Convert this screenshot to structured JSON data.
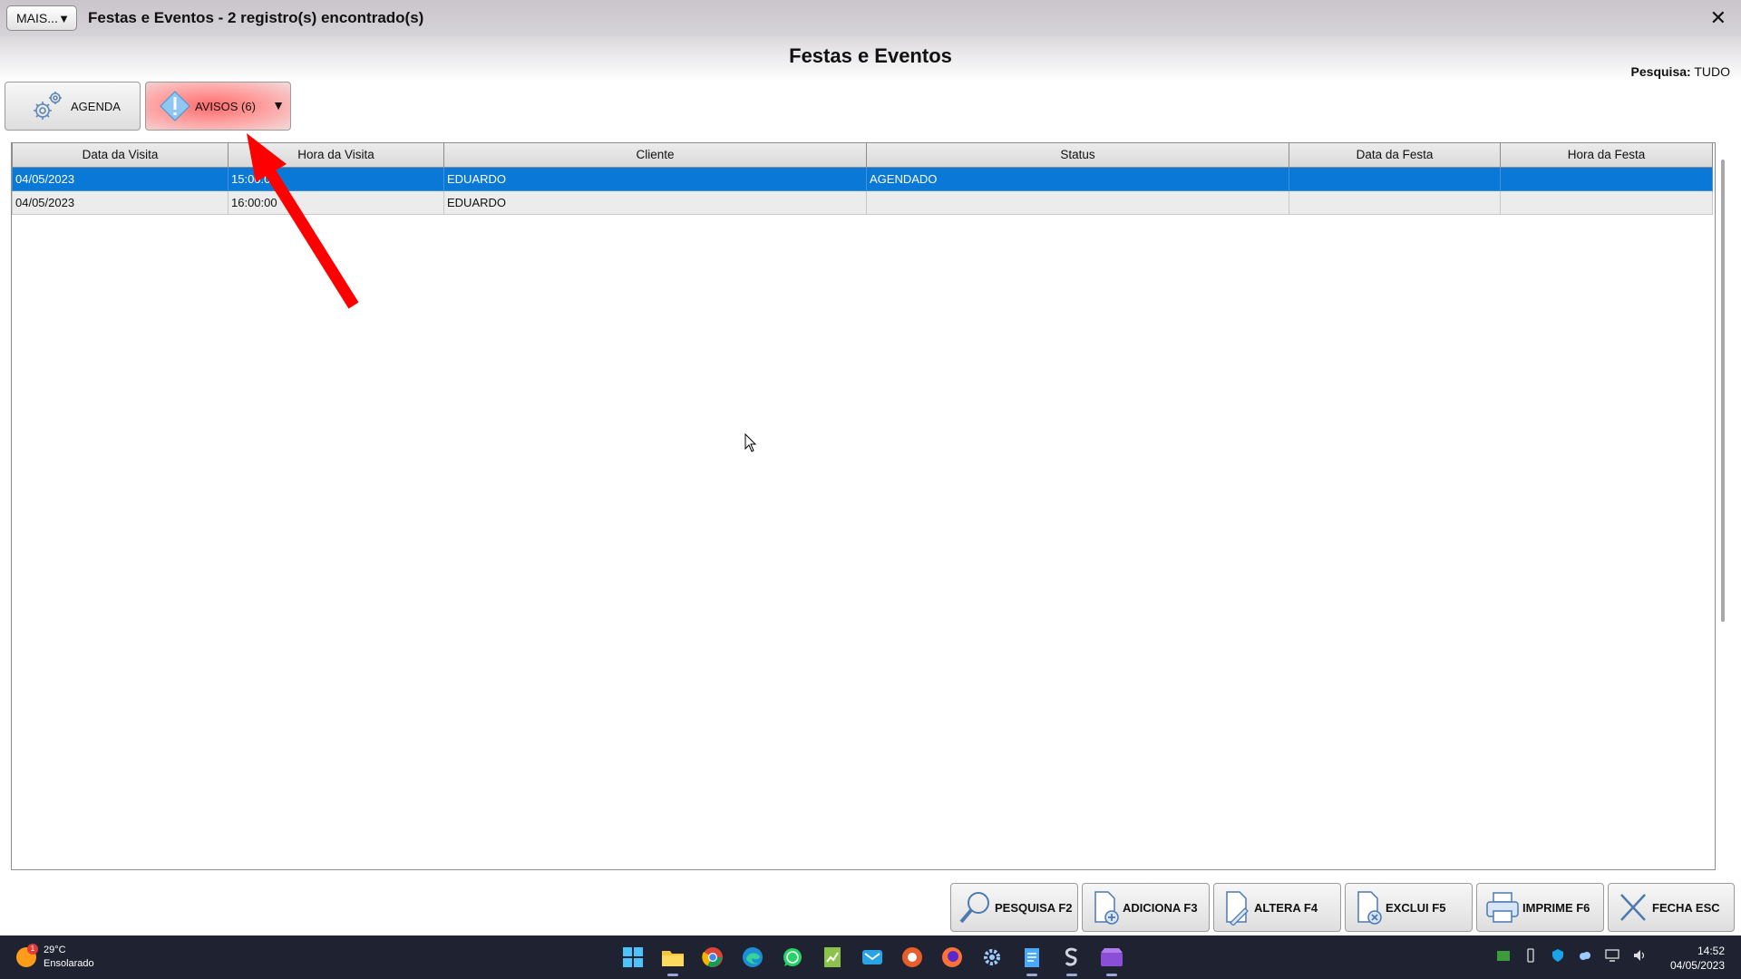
{
  "window": {
    "mais_label": "MAIS...",
    "title": "Festas e Eventos - 2 registro(s) encontrado(s)",
    "close": "✕"
  },
  "header": {
    "title": "Festas e Eventos",
    "search_label": "Pesquisa:",
    "search_value": "TUDO"
  },
  "toolbar": {
    "agenda_label": "AGENDA",
    "avisos_label": "AVISOS (6)"
  },
  "grid": {
    "columns": [
      "Data da Visita",
      "Hora da Visita",
      "Cliente",
      "Status",
      "Data da Festa",
      "Hora da Festa"
    ],
    "rows": [
      [
        "04/05/2023",
        "15:00:00",
        "EDUARDO",
        "AGENDADO",
        "",
        ""
      ],
      [
        "04/05/2023",
        "16:00:00",
        "EDUARDO",
        "",
        "",
        ""
      ]
    ]
  },
  "actions": {
    "pesquisa": "PESQUISA F2",
    "adiciona": "ADICIONA F3",
    "altera": "ALTERA F4",
    "exclui": "EXCLUI F5",
    "imprime": "IMPRIME F6",
    "fecha": "FECHA ESC"
  },
  "taskbar": {
    "weather_badge": "1",
    "temperature": "29°C",
    "condition": "Ensolarado",
    "time": "14:52",
    "date": "04/05/2023",
    "apps": [
      "windows-start-icon",
      "file-explorer-icon",
      "chrome-icon",
      "edge-icon",
      "whatsapp-icon",
      "spreadsheet-icon",
      "mail-icon",
      "media-app-icon",
      "firefox-icon",
      "settings-icon",
      "notepad-icon",
      "erp-app-icon",
      "video-app-icon"
    ]
  },
  "colors": {
    "selection": "#0a78d7",
    "alert": "#ff6b6b",
    "annotation_arrow": "#ff0000"
  }
}
